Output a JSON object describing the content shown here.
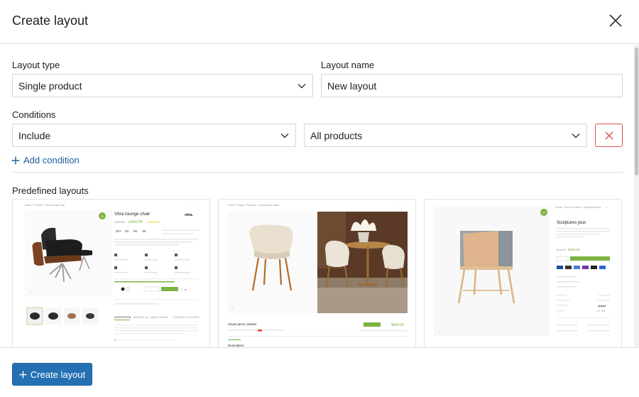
{
  "dialog": {
    "title": "Create layout"
  },
  "form": {
    "layout_type_label": "Layout type",
    "layout_type_value": "Single product",
    "layout_name_label": "Layout name",
    "layout_name_value": "New layout",
    "conditions_label": "Conditions",
    "condition_mode_value": "Include",
    "condition_target_value": "All products",
    "add_condition_label": "Add condition"
  },
  "predefined": {
    "label": "Predefined layouts",
    "cards": [
      {
        "breadcrumb": "Home / Furniture / Vitra lounge chair",
        "product_name": "Vitra lounge chair",
        "brand": "vitra.",
        "old_price": "£499.00",
        "price": "£400.00",
        "badge": "-20%",
        "countdown": [
          "207",
          "03",
          "55",
          "25"
        ],
        "tabs": [
          "DESCRIPTION",
          "REVIEWS (2)",
          "ABOUT BRAND",
          "SHIPPING & DELIVERY"
        ]
      },
      {
        "breadcrumb": "Home / Design / Furniture / Vivant janus chairs",
        "product_name": "Vivant janus charles",
        "price": "$499.00",
        "section": "Description"
      },
      {
        "breadcrumb": "Home / Shop / Furniture / Sculptures jeux",
        "product_name": "Sculptures jeux",
        "badge": "-5%",
        "old_price": "$419.00",
        "price": "$399.00",
        "brand": "zuiver"
      }
    ]
  },
  "footer": {
    "create_label": "Create layout"
  },
  "colors": {
    "primary": "#2470b3",
    "link": "#1a5e9e",
    "danger": "#d94f4f",
    "accent_green": "#7cb342",
    "border": "#d6d6d6"
  }
}
